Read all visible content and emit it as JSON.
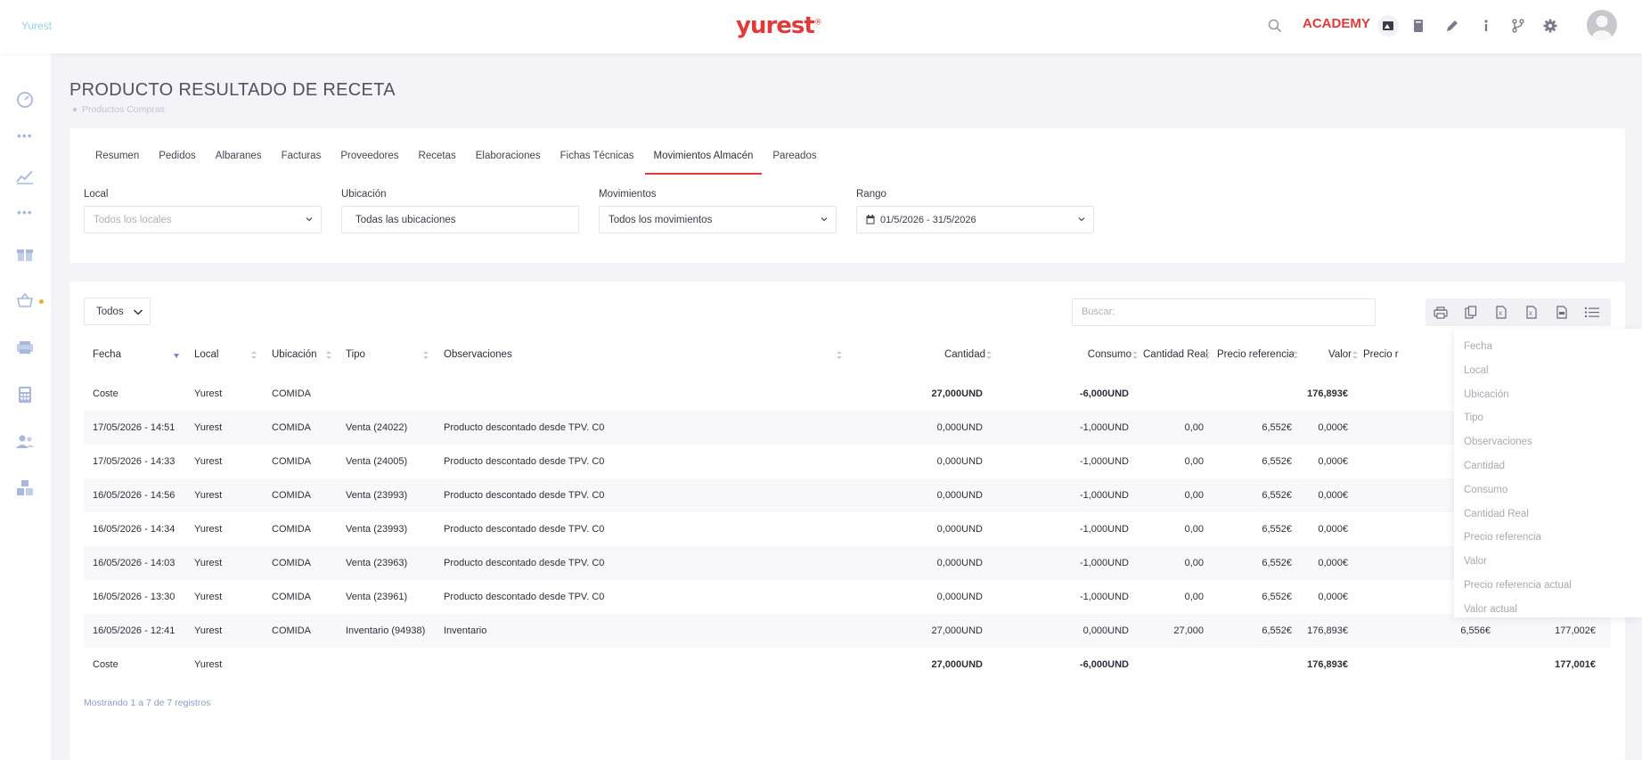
{
  "topbar": {
    "brand_left": "Yurest",
    "logo": "yurest",
    "academy": "ACADEMY",
    "icons": [
      "search-icon",
      "image-icon",
      "book-icon",
      "pencil-icon",
      "info-icon",
      "branch-icon",
      "gear-icon",
      "avatar"
    ]
  },
  "sidebar": {
    "icons": [
      "dashboard-icon",
      "dots-icon",
      "chart-icon",
      "dots-icon",
      "gift-icon",
      "basket-icon",
      "printer-icon",
      "calculator-icon",
      "users-icon",
      "boxes-icon"
    ]
  },
  "page": {
    "title": "PRODUCTO RESULTADO DE RECETA",
    "breadcrumb": "Productos Compras"
  },
  "tabs": [
    "Resumen",
    "Pedidos",
    "Albaranes",
    "Facturas",
    "Proveedores",
    "Recetas",
    "Elaboraciones",
    "Fichas Técnicas",
    "Movimientos Almacén",
    "Pareados"
  ],
  "active_tab": "Movimientos Almacén",
  "filters": {
    "local": {
      "label": "Local",
      "placeholder": "Todos los locales"
    },
    "ubicacion": {
      "label": "Ubicación",
      "value": "Todas las ubicaciones"
    },
    "movimientos": {
      "label": "Movimientos",
      "value": "Todos los movimientos"
    },
    "rango": {
      "label": "Rango",
      "value": "01/5/2026 - 31/5/2026"
    }
  },
  "table_controls": {
    "length_value": "Todos",
    "search_placeholder": "Buscar:",
    "buttons": [
      "print-icon",
      "copy-icon",
      "excel-icon",
      "csv-icon",
      "pdf-icon",
      "columns-icon"
    ]
  },
  "table": {
    "headers": [
      "Fecha",
      "Local",
      "Ubicación",
      "Tipo",
      "Observaciones",
      "Cantidad",
      "Consumo",
      "Cantidad Real",
      "Precio referencia",
      "Valor",
      "Precio r"
    ],
    "summary_top": {
      "fecha": "Coste",
      "local": "Yurest",
      "ubicacion": "COMIDA",
      "cantidad": "27,000UND",
      "consumo": "-6,000UND",
      "valor": "176,893€"
    },
    "rows": [
      {
        "fecha": "17/05/2026 - 14:51",
        "local": "Yurest",
        "ubicacion": "COMIDA",
        "tipo": "Venta (24022)",
        "obs": "Producto descontado desde TPV. C0",
        "cantidad": "0,000UND",
        "consumo": "-1,000UND",
        "cantidad_real": "0,00",
        "precio_ref": "6,552€",
        "valor": "0,000€",
        "precio_ref_actual": "",
        "valor_actual": ""
      },
      {
        "fecha": "17/05/2026 - 14:33",
        "local": "Yurest",
        "ubicacion": "COMIDA",
        "tipo": "Venta (24005)",
        "obs": "Producto descontado desde TPV. C0",
        "cantidad": "0,000UND",
        "consumo": "-1,000UND",
        "cantidad_real": "0,00",
        "precio_ref": "6,552€",
        "valor": "0,000€",
        "precio_ref_actual": "",
        "valor_actual": ""
      },
      {
        "fecha": "16/05/2026 - 14:56",
        "local": "Yurest",
        "ubicacion": "COMIDA",
        "tipo": "Venta (23993)",
        "obs": "Producto descontado desde TPV. C0",
        "cantidad": "0,000UND",
        "consumo": "-1,000UND",
        "cantidad_real": "0,00",
        "precio_ref": "6,552€",
        "valor": "0,000€",
        "precio_ref_actual": "",
        "valor_actual": ""
      },
      {
        "fecha": "16/05/2026 - 14:34",
        "local": "Yurest",
        "ubicacion": "COMIDA",
        "tipo": "Venta (23993)",
        "obs": "Producto descontado desde TPV. C0",
        "cantidad": "0,000UND",
        "consumo": "-1,000UND",
        "cantidad_real": "0,00",
        "precio_ref": "6,552€",
        "valor": "0,000€",
        "precio_ref_actual": "",
        "valor_actual": ""
      },
      {
        "fecha": "16/05/2026 - 14:03",
        "local": "Yurest",
        "ubicacion": "COMIDA",
        "tipo": "Venta (23963)",
        "obs": "Producto descontado desde TPV. C0",
        "cantidad": "0,000UND",
        "consumo": "-1,000UND",
        "cantidad_real": "0,00",
        "precio_ref": "6,552€",
        "valor": "0,000€",
        "precio_ref_actual": "",
        "valor_actual": ""
      },
      {
        "fecha": "16/05/2026 - 13:30",
        "local": "Yurest",
        "ubicacion": "COMIDA",
        "tipo": "Venta (23961)",
        "obs": "Producto descontado desde TPV. C0",
        "cantidad": "0,000UND",
        "consumo": "-1,000UND",
        "cantidad_real": "0,00",
        "precio_ref": "6,552€",
        "valor": "0,000€",
        "precio_ref_actual": "",
        "valor_actual": ""
      },
      {
        "fecha": "16/05/2026 - 12:41",
        "local": "Yurest",
        "ubicacion": "COMIDA",
        "tipo": "Inventario (94938)",
        "obs": "Inventario",
        "cantidad": "27,000UND",
        "consumo": "0,000UND",
        "cantidad_real": "27,000",
        "precio_ref": "6,552€",
        "valor": "176,893€",
        "precio_ref_actual": "6,556€",
        "valor_actual": "177,002€"
      }
    ],
    "summary_bottom": {
      "fecha": "Coste",
      "local": "Yurest",
      "cantidad": "27,000UND",
      "consumo": "-6,000UND",
      "valor": "176,893€",
      "valor_actual": "177,001€"
    },
    "info": "Mostrando 1 a 7 de 7 registros"
  },
  "column_menu": [
    "Fecha",
    "Local",
    "Ubicación",
    "Tipo",
    "Observaciones",
    "Cantidad",
    "Consumo",
    "Cantidad Real",
    "Precio referencia",
    "Valor",
    "Precio referencia actual",
    "Valor actual"
  ],
  "colors": {
    "accent": "#e03a3a",
    "sidebar_icon": "#a8b8dc",
    "academy": "#e03a3a"
  }
}
